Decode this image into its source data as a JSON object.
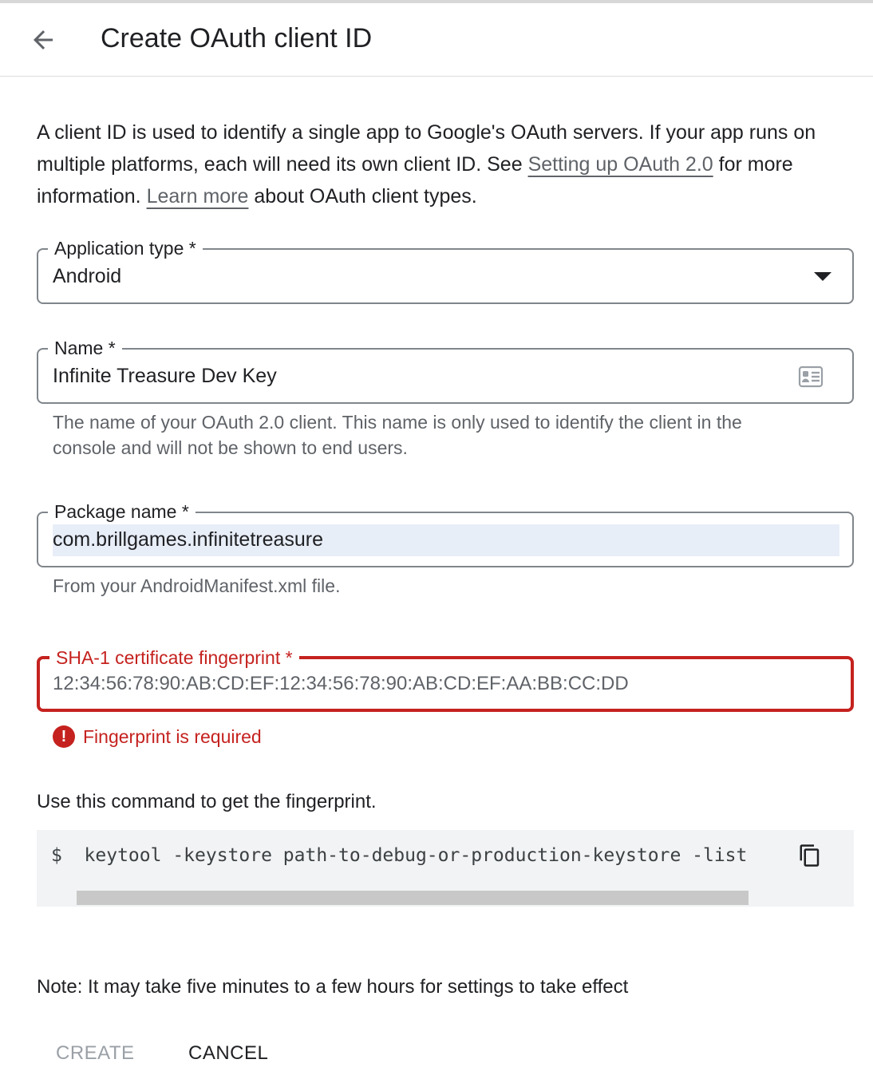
{
  "header": {
    "title": "Create OAuth client ID",
    "back_icon": "arrow-back-icon"
  },
  "intro": {
    "part1": "A client ID is used to identify a single app to Google's OAuth servers. If your app runs on multiple platforms, each will need its own client ID. See ",
    "link1": "Setting up OAuth 2.0",
    "part2": " for more information. ",
    "link2": "Learn more",
    "part3": " about OAuth client types."
  },
  "application_type": {
    "label": "Application type *",
    "value": "Android",
    "icon": "dropdown-arrow-icon"
  },
  "name_field": {
    "label": "Name *",
    "value": "Infinite Treasure Dev Key",
    "icon": "contact-card-icon",
    "helper": "The name of your OAuth 2.0 client. This name is only used to identify the client in the console and will not be shown to end users."
  },
  "package_field": {
    "label": "Package name *",
    "value": "com.brillgames.infinitetreasure",
    "helper": "From your AndroidManifest.xml file."
  },
  "sha_field": {
    "label": "SHA-1 certificate fingerprint *",
    "placeholder": "12:34:56:78:90:AB:CD:EF:12:34:56:78:90:AB:CD:EF:AA:BB:CC:DD",
    "error": "Fingerprint is required",
    "error_icon": "error-icon"
  },
  "command": {
    "hint": "Use this command to get the fingerprint.",
    "code": "$  keytool -keystore path-to-debug-or-production-keystore -list",
    "copy_icon": "copy-icon"
  },
  "note": "Note: It may take five minutes to a few hours for settings to take effect",
  "buttons": {
    "create": "CREATE",
    "cancel": "CANCEL"
  },
  "colors": {
    "error": "#c5221f",
    "border": "#80868b",
    "link": "#5f6368",
    "disabled": "#9aa0a6",
    "code_bg": "#f1f3f4",
    "autofill_bg": "#e8eef8"
  }
}
